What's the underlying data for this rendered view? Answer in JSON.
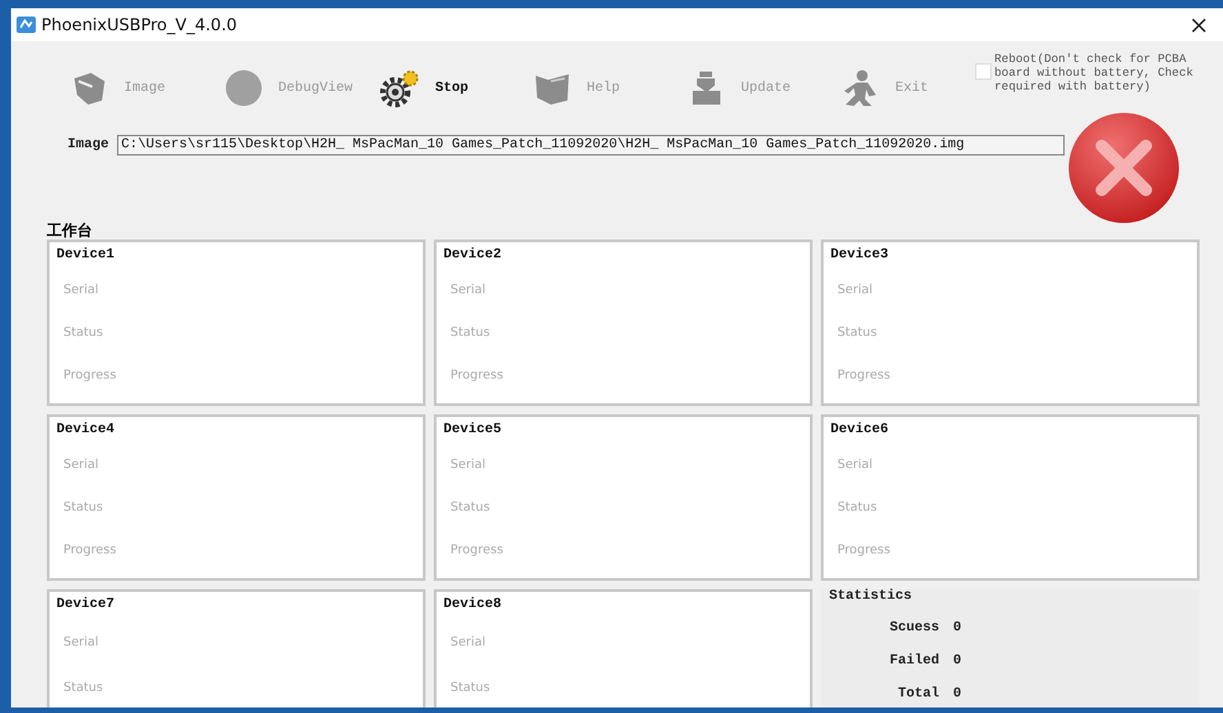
{
  "window": {
    "title": "PhoenixUSBPro_V_4.0.0"
  },
  "toolbar": [
    {
      "label": "Image",
      "enabled": false
    },
    {
      "label": "DebugView",
      "enabled": false
    },
    {
      "label": "Stop",
      "enabled": true
    },
    {
      "label": "Help",
      "enabled": false
    },
    {
      "label": "Update",
      "enabled": false
    },
    {
      "label": "Exit",
      "enabled": false
    }
  ],
  "reboot_option": {
    "label": "Reboot(Don't check for PCBA board without battery, Check required with battery)",
    "checked": false
  },
  "image_field": {
    "label": "Image",
    "value": "C:\\Users\\sr115\\Desktop\\H2H_ MsPacMan_10 Games_Patch_11092020\\H2H_ MsPacMan_10 Games_Patch_11092020.img"
  },
  "workbench": {
    "title": "工作台",
    "devices": [
      {
        "name": "Device1",
        "fields": [
          "Serial",
          "Status",
          "Progress"
        ]
      },
      {
        "name": "Device2",
        "fields": [
          "Serial",
          "Status",
          "Progress"
        ]
      },
      {
        "name": "Device3",
        "fields": [
          "Serial",
          "Status",
          "Progress"
        ]
      },
      {
        "name": "Device4",
        "fields": [
          "Serial",
          "Status",
          "Progress"
        ]
      },
      {
        "name": "Device5",
        "fields": [
          "Serial",
          "Status",
          "Progress"
        ]
      },
      {
        "name": "Device6",
        "fields": [
          "Serial",
          "Status",
          "Progress"
        ]
      },
      {
        "name": "Device7",
        "fields": [
          "Serial",
          "Status"
        ]
      },
      {
        "name": "Device8",
        "fields": [
          "Serial",
          "Status"
        ]
      }
    ]
  },
  "statistics": {
    "title": "Statistics",
    "rows": [
      {
        "label": "Scuess",
        "value": "0"
      },
      {
        "label": "Failed",
        "value": "0"
      },
      {
        "label": "Total",
        "value": "0"
      }
    ]
  }
}
